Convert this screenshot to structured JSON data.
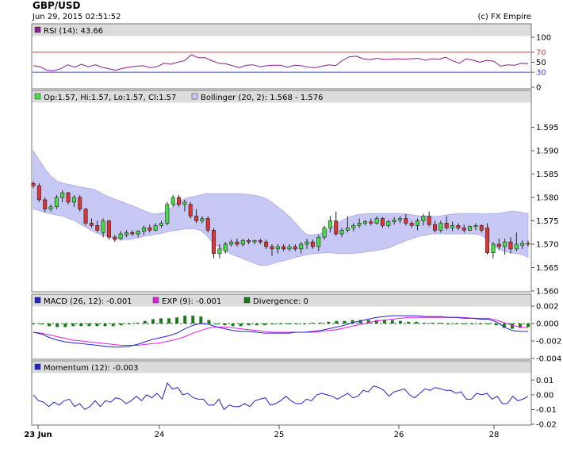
{
  "header": {
    "title": "GBP/USD",
    "date": "Jun 29, 2015 02:51:52",
    "copyright": "(c) FX Empire"
  },
  "chart_data": [
    {
      "type": "line",
      "panel": "rsi",
      "legend": "RSI (14): 43.66",
      "ylim": [
        0,
        100
      ],
      "yticks": [
        "100",
        "70",
        "50",
        "30",
        "0"
      ],
      "reference_lines": [
        {
          "value": 70,
          "label": "70",
          "color": "#e03c3c"
        },
        {
          "value": 30,
          "label": "30",
          "color": "#3c3ce0"
        }
      ],
      "series": [
        {
          "color": "#8b1f8b",
          "values": [
            43,
            41,
            34,
            33,
            37,
            45,
            40,
            46,
            41,
            45,
            40,
            37,
            34,
            38,
            40,
            42,
            43,
            39,
            41,
            48,
            46,
            50,
            53,
            65,
            59,
            59,
            53,
            48,
            47,
            43,
            39,
            44,
            45,
            41,
            43,
            44,
            44,
            40,
            44,
            43,
            40,
            39,
            42,
            45,
            43,
            54,
            61,
            62,
            57,
            55,
            58,
            56,
            56,
            57,
            56,
            57,
            58,
            54,
            57,
            56,
            60,
            53,
            48,
            57,
            54,
            50,
            54,
            52,
            42,
            45,
            44,
            48,
            47
          ]
        }
      ]
    },
    {
      "type": "candlestick",
      "panel": "price",
      "legend_price": "Op:1.57, Hi:1.57, Lo:1.57, Cl:1.57",
      "legend_bollinger": "Bollinger (20, 2): 1.568 - 1.576",
      "ylim": [
        1.56,
        1.6
      ],
      "yticks": [
        "1.595",
        "1.590",
        "1.585",
        "1.580",
        "1.575",
        "1.570",
        "1.565",
        "1.560"
      ],
      "colors": {
        "up": "#44dd44",
        "down": "#dd3333",
        "band_fill": "#c8c8f4",
        "band_line": "#a8a8e8"
      },
      "candles": [
        [
          1.583,
          1.5835,
          1.582,
          1.5825
        ],
        [
          1.5825,
          1.583,
          1.579,
          1.5795
        ],
        [
          1.5795,
          1.58,
          1.5768,
          1.5775
        ],
        [
          1.5775,
          1.5785,
          1.577,
          1.578
        ],
        [
          1.578,
          1.5805,
          1.5775,
          1.58
        ],
        [
          1.58,
          1.5815,
          1.579,
          1.581
        ],
        [
          1.581,
          1.5812,
          1.5785,
          1.579
        ],
        [
          1.579,
          1.5805,
          1.578,
          1.58
        ],
        [
          1.58,
          1.5805,
          1.577,
          1.5775
        ],
        [
          1.5775,
          1.5778,
          1.574,
          1.5745
        ],
        [
          1.5745,
          1.5755,
          1.5735,
          1.574
        ],
        [
          1.574,
          1.575,
          1.5725,
          1.573
        ],
        [
          1.5725,
          1.5755,
          1.5715,
          1.575
        ],
        [
          1.575,
          1.5752,
          1.571,
          1.5715
        ],
        [
          1.5715,
          1.572,
          1.5705,
          1.571
        ],
        [
          1.5712,
          1.5728,
          1.5708,
          1.5722
        ],
        [
          1.572,
          1.573,
          1.5715,
          1.5725
        ],
        [
          1.5725,
          1.573,
          1.5718,
          1.5722
        ],
        [
          1.5722,
          1.573,
          1.5715,
          1.5728
        ],
        [
          1.5728,
          1.574,
          1.572,
          1.5735
        ],
        [
          1.5735,
          1.5742,
          1.5725,
          1.573
        ],
        [
          1.573,
          1.5745,
          1.5728,
          1.574
        ],
        [
          1.574,
          1.575,
          1.5735,
          1.5745
        ],
        [
          1.5745,
          1.579,
          1.574,
          1.5785
        ],
        [
          1.5785,
          1.5805,
          1.578,
          1.58
        ],
        [
          1.58,
          1.5805,
          1.578,
          1.5785
        ],
        [
          1.5785,
          1.5795,
          1.577,
          1.579
        ],
        [
          1.5785,
          1.579,
          1.5755,
          1.576
        ],
        [
          1.576,
          1.5775,
          1.5745,
          1.575
        ],
        [
          1.575,
          1.576,
          1.5745,
          1.5755
        ],
        [
          1.5755,
          1.576,
          1.5725,
          1.573
        ],
        [
          1.573,
          1.5735,
          1.567,
          1.568
        ],
        [
          1.568,
          1.57,
          1.567,
          1.569
        ],
        [
          1.5685,
          1.5705,
          1.568,
          1.57
        ],
        [
          1.57,
          1.571,
          1.5695,
          1.5705
        ],
        [
          1.5705,
          1.5712,
          1.5695,
          1.57
        ],
        [
          1.57,
          1.5712,
          1.5695,
          1.5708
        ],
        [
          1.5708,
          1.5712,
          1.57,
          1.5705
        ],
        [
          1.5705,
          1.571,
          1.57,
          1.5708
        ],
        [
          1.5708,
          1.5712,
          1.57,
          1.5705
        ],
        [
          1.5705,
          1.571,
          1.569,
          1.5695
        ],
        [
          1.5695,
          1.57,
          1.5675,
          1.569
        ],
        [
          1.569,
          1.57,
          1.568,
          1.5695
        ],
        [
          1.5695,
          1.57,
          1.5685,
          1.569
        ],
        [
          1.569,
          1.57,
          1.5685,
          1.5695
        ],
        [
          1.5695,
          1.57,
          1.5685,
          1.569
        ],
        [
          1.569,
          1.5705,
          1.568,
          1.57
        ],
        [
          1.57,
          1.5712,
          1.569,
          1.5705
        ],
        [
          1.5705,
          1.571,
          1.569,
          1.5695
        ],
        [
          1.5695,
          1.572,
          1.5685,
          1.5715
        ],
        [
          1.5715,
          1.574,
          1.571,
          1.5735
        ],
        [
          1.5735,
          1.576,
          1.5725,
          1.575
        ],
        [
          1.575,
          1.577,
          1.5718,
          1.5722
        ],
        [
          1.5722,
          1.5735,
          1.5715,
          1.573
        ],
        [
          1.573,
          1.576,
          1.5725,
          1.5735
        ],
        [
          1.5735,
          1.5745,
          1.5728,
          1.574
        ],
        [
          1.574,
          1.5755,
          1.5735,
          1.5745
        ],
        [
          1.5745,
          1.5752,
          1.574,
          1.5748
        ],
        [
          1.5748,
          1.5755,
          1.574,
          1.5745
        ],
        [
          1.5745,
          1.576,
          1.5742,
          1.5755
        ],
        [
          1.5755,
          1.5758,
          1.5735,
          1.574
        ],
        [
          1.574,
          1.5752,
          1.5735,
          1.5748
        ],
        [
          1.5748,
          1.5758,
          1.5742,
          1.5752
        ],
        [
          1.5752,
          1.576,
          1.5745,
          1.5755
        ],
        [
          1.5755,
          1.5765,
          1.574,
          1.5745
        ],
        [
          1.5745,
          1.575,
          1.5735,
          1.574
        ],
        [
          1.574,
          1.5755,
          1.573,
          1.575
        ],
        [
          1.575,
          1.5765,
          1.574,
          1.576
        ],
        [
          1.576,
          1.577,
          1.5738,
          1.5742
        ],
        [
          1.5742,
          1.575,
          1.5725,
          1.573
        ],
        [
          1.573,
          1.575,
          1.5725,
          1.5745
        ],
        [
          1.5745,
          1.576,
          1.573,
          1.5735
        ],
        [
          1.5735,
          1.5748,
          1.5728,
          1.574
        ],
        [
          1.574,
          1.5745,
          1.573,
          1.5735
        ],
        [
          1.5735,
          1.5742,
          1.5725,
          1.573
        ],
        [
          1.573,
          1.574,
          1.5728,
          1.5738
        ],
        [
          1.5738,
          1.5745,
          1.573,
          1.574
        ],
        [
          1.574,
          1.5742,
          1.5725,
          1.573
        ],
        [
          1.5735,
          1.5745,
          1.5678,
          1.5682
        ],
        [
          1.5682,
          1.5705,
          1.567,
          1.57
        ],
        [
          1.57,
          1.5712,
          1.5688,
          1.5695
        ],
        [
          1.5695,
          1.5712,
          1.5678,
          1.5705
        ],
        [
          1.5705,
          1.5715,
          1.568,
          1.569
        ],
        [
          1.569,
          1.5725,
          1.5685,
          1.57
        ],
        [
          1.5698,
          1.5708,
          1.569,
          1.5702
        ],
        [
          1.5702,
          1.5708,
          1.5695,
          1.57
        ]
      ],
      "bollinger_upper": [
        1.59,
        1.588,
        1.586,
        1.5845,
        1.5835,
        1.583,
        1.5828,
        1.5825,
        1.5822,
        1.582,
        1.5818,
        1.5812,
        1.5805,
        1.58,
        1.5795,
        1.579,
        1.5785,
        1.578,
        1.5775,
        1.577,
        1.5765,
        1.5765,
        1.5768,
        1.5775,
        1.5788,
        1.5795,
        1.58,
        1.5802,
        1.5805,
        1.5808,
        1.5808,
        1.5808,
        1.5808,
        1.5808,
        1.5808,
        1.5808,
        1.5806,
        1.5805,
        1.5802,
        1.5798,
        1.579,
        1.578,
        1.577,
        1.5758,
        1.5745,
        1.573,
        1.572,
        1.572,
        1.5722,
        1.5728,
        1.5735,
        1.5745,
        1.5752,
        1.5758,
        1.5762,
        1.5764,
        1.5765,
        1.5766,
        1.5766,
        1.5766,
        1.5766,
        1.5766,
        1.5765,
        1.5764,
        1.5762,
        1.576,
        1.576,
        1.576,
        1.576,
        1.5762,
        1.5764,
        1.5765,
        1.5766,
        1.5766,
        1.5766,
        1.5765,
        1.5765,
        1.5766,
        1.5766,
        1.5768,
        1.577,
        1.577,
        1.5768,
        1.5765
      ],
      "bollinger_lower": [
        1.5775,
        1.5772,
        1.5768,
        1.5765,
        1.5762,
        1.576,
        1.5755,
        1.575,
        1.5742,
        1.5735,
        1.5728,
        1.5722,
        1.5718,
        1.5715,
        1.5712,
        1.571,
        1.571,
        1.5712,
        1.5715,
        1.5718,
        1.572,
        1.5722,
        1.5725,
        1.5728,
        1.573,
        1.5732,
        1.5733,
        1.5733,
        1.573,
        1.572,
        1.5705,
        1.5695,
        1.5688,
        1.568,
        1.5675,
        1.567,
        1.5665,
        1.566,
        1.5655,
        1.5655,
        1.5658,
        1.5662,
        1.5665,
        1.5668,
        1.5672,
        1.5675,
        1.5678,
        1.568,
        1.5681,
        1.5682,
        1.5682,
        1.568,
        1.568,
        1.568,
        1.5681,
        1.5682,
        1.5684,
        1.5686,
        1.5688,
        1.569,
        1.5694,
        1.57,
        1.5705,
        1.571,
        1.5714,
        1.5718,
        1.572,
        1.5722,
        1.5722,
        1.5722,
        1.5722,
        1.5722,
        1.5722,
        1.5722,
        1.5722,
        1.572,
        1.5712,
        1.57,
        1.569,
        1.5685,
        1.5682,
        1.568,
        1.5678,
        1.5672
      ]
    },
    {
      "type": "line",
      "panel": "macd",
      "legend_macd": "MACD (26, 12): -0.001",
      "legend_exp": "EXP (9): -0.001",
      "legend_div": "Divergence: 0",
      "ylim": [
        -0.004,
        0.002
      ],
      "yticks": [
        "0.002",
        "0.000",
        "-0.002",
        "-0.004"
      ],
      "series": [
        {
          "name": "MACD (26, 12)",
          "color": "#2222cc",
          "values": [
            -0.001,
            -0.0012,
            -0.0016,
            -0.0019,
            -0.0021,
            -0.0022,
            -0.0023,
            -0.0024,
            -0.0025,
            -0.0026,
            -0.0027,
            -0.0027,
            -0.0026,
            -0.0024,
            -0.0021,
            -0.0018,
            -0.0016,
            -0.0014,
            -0.0011,
            -0.0006,
            -0.0002,
            0.0,
            -0.0001,
            -0.0004,
            -0.0006,
            -0.0008,
            -0.0009,
            -0.0009,
            -0.001,
            -0.0011,
            -0.0011,
            -0.0011,
            -0.0011,
            -0.001,
            -0.001,
            -0.0009,
            -0.0008,
            -0.0006,
            -0.0004,
            -0.0002,
            0.0001,
            0.0003,
            0.0005,
            0.0007,
            0.0008,
            0.0009,
            0.0009,
            0.0009,
            0.0009,
            0.0008,
            0.0008,
            0.0008,
            0.0007,
            0.0007,
            0.0006,
            0.0006,
            0.0005,
            0.0005,
            0.0002,
            -0.0004,
            -0.0008,
            -0.0009,
            -0.0009
          ]
        },
        {
          "name": "EXP (9)",
          "color": "#e020e0",
          "values": [
            -0.001,
            -0.0011,
            -0.0013,
            -0.0015,
            -0.0017,
            -0.0019,
            -0.002,
            -0.0021,
            -0.0022,
            -0.0023,
            -0.0024,
            -0.0025,
            -0.0025,
            -0.0025,
            -0.0024,
            -0.0023,
            -0.0022,
            -0.002,
            -0.0018,
            -0.0015,
            -0.0011,
            -0.0008,
            -0.0005,
            -0.0004,
            -0.0004,
            -0.0005,
            -0.0006,
            -0.0007,
            -0.0008,
            -0.0009,
            -0.001,
            -0.001,
            -0.001,
            -0.001,
            -0.001,
            -0.001,
            -0.0009,
            -0.0008,
            -0.0007,
            -0.0005,
            -0.0003,
            -0.0001,
            0.0001,
            0.0003,
            0.0004,
            0.0005,
            0.0006,
            0.0007,
            0.0007,
            0.0007,
            0.0007,
            0.0007,
            0.0007,
            0.0007,
            0.0007,
            0.0006,
            0.0006,
            0.0006,
            0.0004,
            0.0001,
            -0.0002,
            -0.0004,
            -0.0005
          ]
        },
        {
          "name": "Divergence",
          "color": "#1a7a1a",
          "type": "bar",
          "values": [
            0.0,
            -0.0001,
            -0.0003,
            -0.0004,
            -0.0004,
            -0.0003,
            -0.0003,
            -0.0003,
            -0.0003,
            -0.0003,
            -0.0003,
            -0.0002,
            -0.0001,
            0.0001,
            0.0003,
            0.0005,
            0.0006,
            0.0006,
            0.0007,
            0.0009,
            0.0009,
            0.0008,
            0.0004,
            0.0,
            -0.0002,
            -0.0003,
            -0.0003,
            -0.0002,
            -0.0002,
            -0.0002,
            -0.0001,
            -0.0001,
            -0.0001,
            0.0,
            0.0,
            0.0001,
            0.0001,
            0.0002,
            0.0003,
            0.0003,
            0.0004,
            0.0004,
            0.0004,
            0.0004,
            0.0004,
            0.0004,
            0.0003,
            0.0002,
            0.0002,
            0.0001,
            0.0001,
            0.0001,
            0.0,
            0.0,
            -0.0001,
            0.0,
            -0.0001,
            -0.0001,
            -0.0002,
            -0.0005,
            -0.0006,
            -0.0005,
            -0.0004
          ]
        }
      ]
    },
    {
      "type": "line",
      "panel": "momentum",
      "legend": "Momentum (12): -0.003",
      "ylim": [
        -0.02,
        0.015
      ],
      "yticks": [
        "0.01",
        "0.00",
        "-0.01",
        "-0.02"
      ],
      "series": [
        {
          "color": "#2222cc",
          "values": [
            0.0,
            -0.004,
            -0.005,
            -0.008,
            -0.005,
            -0.007,
            -0.004,
            -0.003,
            -0.008,
            -0.006,
            -0.01,
            -0.008,
            -0.004,
            -0.008,
            -0.004,
            -0.005,
            -0.002,
            -0.003,
            -0.006,
            -0.004,
            -0.001,
            -0.004,
            0.0,
            -0.002,
            0.001,
            -0.003,
            0.008,
            0.004,
            0.005,
            0.0,
            0.001,
            -0.002,
            -0.003,
            -0.003,
            -0.007,
            -0.007,
            -0.003,
            -0.01,
            -0.007,
            -0.008,
            -0.008,
            -0.006,
            -0.008,
            -0.004,
            -0.003,
            -0.002,
            -0.007,
            -0.006,
            -0.004,
            -0.001,
            -0.004,
            -0.006,
            -0.006,
            -0.003,
            -0.004,
            0.0,
            0.001,
            0.0,
            -0.001,
            -0.003,
            -0.001,
            0.001,
            -0.002,
            -0.001,
            0.003,
            0.002,
            0.006,
            0.005,
            0.003,
            -0.001,
            0.002,
            0.003,
            0.004,
            0.0,
            -0.002,
            0.001,
            0.004,
            0.003,
            0.005,
            0.004,
            0.003,
            0.003,
            0.001,
            0.002,
            -0.003,
            -0.003,
            0.001,
            0.0,
            0.001,
            -0.003,
            -0.001,
            -0.006,
            -0.006,
            -0.001,
            -0.004,
            -0.003,
            -0.001
          ]
        }
      ]
    }
  ],
  "x_axis": {
    "labels": [
      "23 Jun",
      "24",
      "25",
      "26",
      "28"
    ]
  }
}
